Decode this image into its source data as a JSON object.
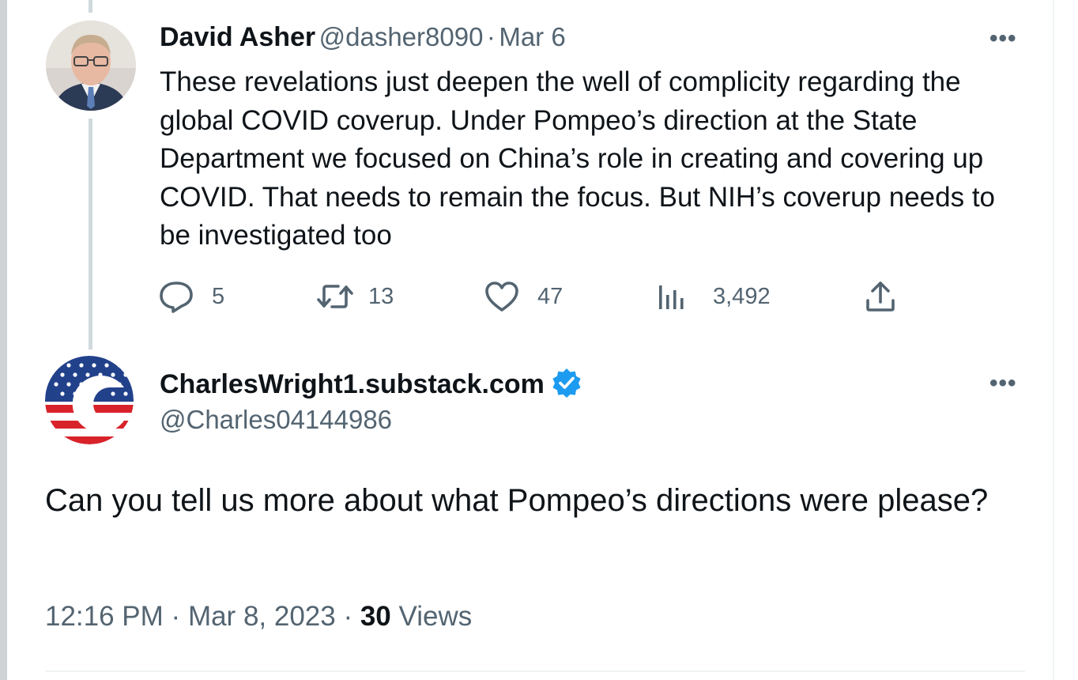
{
  "tweet": {
    "author_name": "David Asher",
    "author_handle": "@dasher8090",
    "separator": "·",
    "date": "Mar 6",
    "text": "These revelations just deepen the well of complicity regarding the global COVID coverup. Under Pompeo’s direction at the State Department we focused on China’s role in creating and covering up COVID. That needs to remain the focus. But NIH’s coverup needs to be investigated too",
    "more_icon": "•••",
    "stats": {
      "replies": "5",
      "retweets": "13",
      "likes": "47",
      "views": "3,492"
    }
  },
  "reply": {
    "author_name": "CharlesWright1.substack.com",
    "author_handle": "@Charles04144986",
    "verified": true,
    "more_icon": "•••",
    "text": "Can you tell us more about what Pompeo’s directions were please?",
    "time": "12:16 PM",
    "separator": "·",
    "date": "Mar 8, 2023",
    "views_count": "30",
    "views_label": "Views"
  },
  "icons": [
    "reply-icon",
    "retweet-icon",
    "like-icon",
    "views-icon",
    "share-icon",
    "more-icon",
    "verified-badge-icon"
  ],
  "colors": {
    "text": "#0f1419",
    "secondary": "#536471",
    "verified": "#1d9bf0",
    "thread_line": "#cfd9de"
  }
}
